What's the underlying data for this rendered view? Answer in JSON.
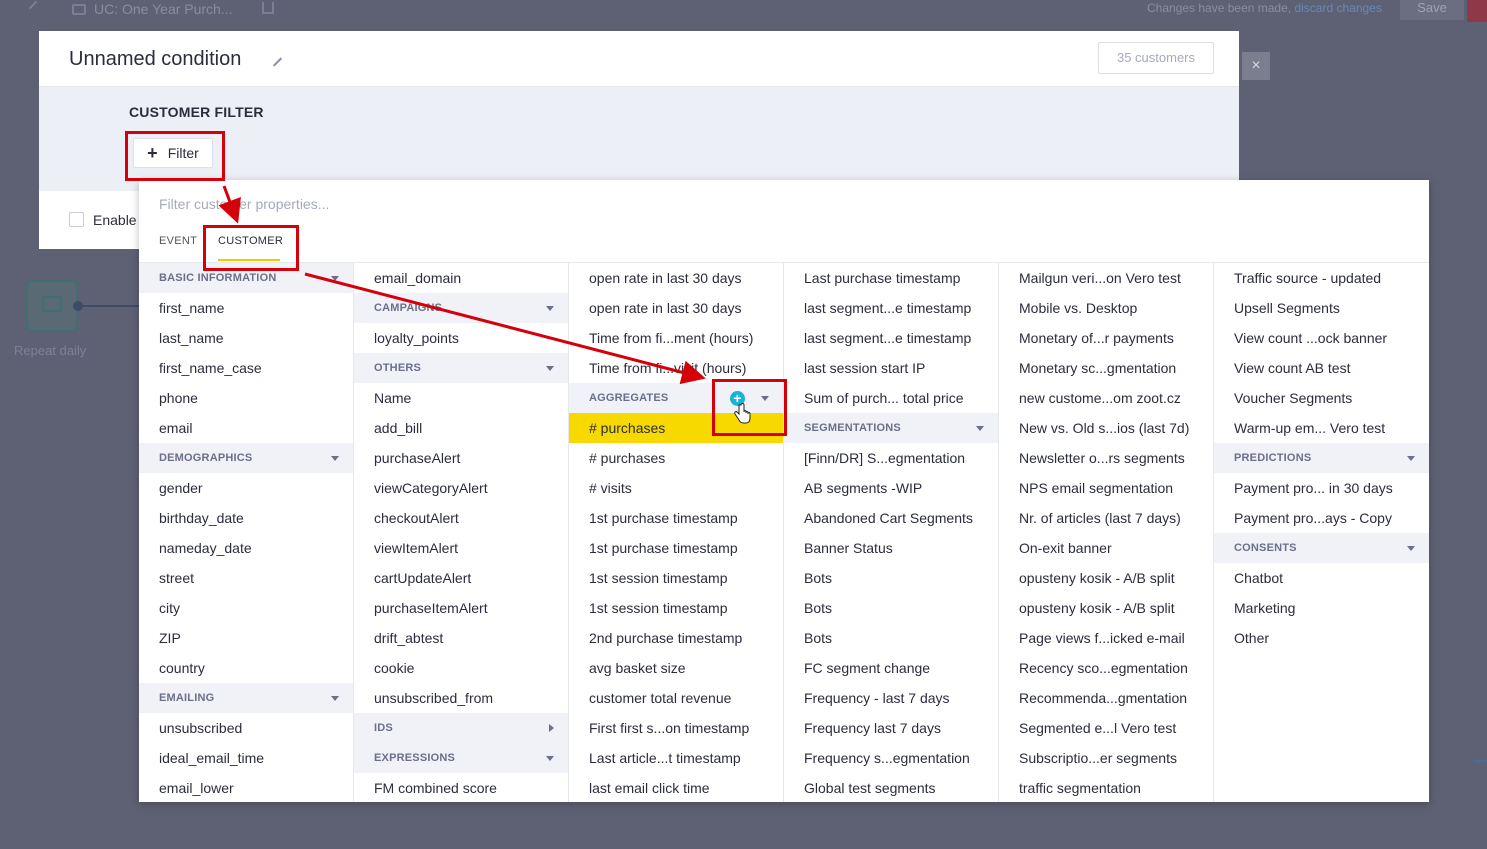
{
  "background": {
    "breadcrumb": "UC: One Year Purch...",
    "changes_text": "Changes have been made,",
    "discard_link": "discard changes",
    "save_label": "Save",
    "node_label": "Repeat daily"
  },
  "modal": {
    "title": "Unnamed condition",
    "customers_count": "35 customers",
    "filter_section_title": "CUSTOMER FILTER",
    "filter_button_label": "Filter",
    "enable_label": "Enable",
    "close_label": "×"
  },
  "picker": {
    "search_placeholder": "Filter customer properties...",
    "tabs": {
      "event": "EVENT",
      "customer": "CUSTOMER"
    },
    "columns": [
      [
        {
          "label": "BASIC INFORMATION",
          "type": "section",
          "caret": "down"
        },
        {
          "label": "first_name"
        },
        {
          "label": "last_name"
        },
        {
          "label": "first_name_case"
        },
        {
          "label": "phone"
        },
        {
          "label": "email"
        },
        {
          "label": "DEMOGRAPHICS",
          "type": "section",
          "caret": "down"
        },
        {
          "label": "gender"
        },
        {
          "label": "birthday_date"
        },
        {
          "label": "nameday_date"
        },
        {
          "label": "street"
        },
        {
          "label": "city"
        },
        {
          "label": "ZIP"
        },
        {
          "label": "country"
        },
        {
          "label": "EMAILING",
          "type": "section",
          "caret": "down"
        },
        {
          "label": "unsubscribed"
        },
        {
          "label": "ideal_email_time"
        },
        {
          "label": "email_lower"
        }
      ],
      [
        {
          "label": "email_domain"
        },
        {
          "label": "CAMPAIGNS",
          "type": "section",
          "caret": "down"
        },
        {
          "label": "loyalty_points"
        },
        {
          "label": "OTHERS",
          "type": "section",
          "caret": "down"
        },
        {
          "label": "Name"
        },
        {
          "label": "add_bill"
        },
        {
          "label": "purchaseAlert"
        },
        {
          "label": "viewCategoryAlert"
        },
        {
          "label": "checkoutAlert"
        },
        {
          "label": "viewItemAlert"
        },
        {
          "label": "cartUpdateAlert"
        },
        {
          "label": "purchaseItemAlert"
        },
        {
          "label": "drift_abtest"
        },
        {
          "label": "cookie"
        },
        {
          "label": "unsubscribed_from"
        },
        {
          "label": "IDS",
          "type": "section",
          "caret": "right"
        },
        {
          "label": "EXPRESSIONS",
          "type": "section",
          "caret": "down"
        },
        {
          "label": "FM combined score"
        }
      ],
      [
        {
          "label": "open rate in last 30 days"
        },
        {
          "label": "open rate in last 30 days"
        },
        {
          "label": "Time from fi...ment (hours)"
        },
        {
          "label": "Time from fi...visit (hours)"
        },
        {
          "label": "AGGREGATES",
          "type": "section",
          "caret": "down",
          "add": true
        },
        {
          "label": "# purchases",
          "highlight": true
        },
        {
          "label": "# purchases"
        },
        {
          "label": "# visits"
        },
        {
          "label": "1st purchase timestamp"
        },
        {
          "label": "1st purchase timestamp"
        },
        {
          "label": "1st session timestamp"
        },
        {
          "label": "1st session timestamp"
        },
        {
          "label": "2nd purchase timestamp"
        },
        {
          "label": "avg basket size"
        },
        {
          "label": "customer total revenue"
        },
        {
          "label": "First first s...on timestamp"
        },
        {
          "label": "Last article...t timestamp"
        },
        {
          "label": "last email click time"
        }
      ],
      [
        {
          "label": "Last purchase timestamp"
        },
        {
          "label": "last segment...e timestamp"
        },
        {
          "label": "last segment...e timestamp"
        },
        {
          "label": "last session start IP"
        },
        {
          "label": "Sum of purch... total price"
        },
        {
          "label": "SEGMENTATIONS",
          "type": "section",
          "caret": "down"
        },
        {
          "label": "[Finn/DR] S...egmentation"
        },
        {
          "label": "AB segments -WIP"
        },
        {
          "label": "Abandoned Cart Segments"
        },
        {
          "label": "Banner Status"
        },
        {
          "label": "Bots"
        },
        {
          "label": "Bots"
        },
        {
          "label": "Bots"
        },
        {
          "label": "FC segment change"
        },
        {
          "label": "Frequency - last 7 days"
        },
        {
          "label": "Frequency last 7 days"
        },
        {
          "label": "Frequency s...egmentation"
        },
        {
          "label": "Global test segments"
        }
      ],
      [
        {
          "label": "Mailgun veri...on Vero test"
        },
        {
          "label": "Mobile vs. Desktop"
        },
        {
          "label": "Monetary of...r payments"
        },
        {
          "label": "Monetary sc...gmentation"
        },
        {
          "label": "new custome...om zoot.cz"
        },
        {
          "label": "New vs. Old s...ios (last 7d)"
        },
        {
          "label": "Newsletter o...rs segments"
        },
        {
          "label": "NPS email segmentation"
        },
        {
          "label": "Nr. of articles (last 7 days)"
        },
        {
          "label": "On-exit banner"
        },
        {
          "label": "opusteny kosik - A/B split"
        },
        {
          "label": "opusteny kosik - A/B split"
        },
        {
          "label": "Page views f...icked e-mail"
        },
        {
          "label": "Recency sco...egmentation"
        },
        {
          "label": "Recommenda...gmentation"
        },
        {
          "label": "Segmented e...l Vero test"
        },
        {
          "label": "Subscriptio...er segments"
        },
        {
          "label": "traffic segmentation"
        }
      ],
      [
        {
          "label": "Traffic source - updated"
        },
        {
          "label": "Upsell Segments"
        },
        {
          "label": "View count ...ock banner"
        },
        {
          "label": "View count AB test"
        },
        {
          "label": "Voucher Segments"
        },
        {
          "label": "Warm-up em... Vero test"
        },
        {
          "label": "PREDICTIONS",
          "type": "section",
          "caret": "down"
        },
        {
          "label": "Payment pro... in 30 days"
        },
        {
          "label": "Payment pro...ays - Copy"
        },
        {
          "label": "CONSENTS",
          "type": "section",
          "caret": "down"
        },
        {
          "label": "Chatbot"
        },
        {
          "label": "Marketing"
        },
        {
          "label": "Other"
        }
      ]
    ]
  },
  "colors": {
    "highlight": "#f7d900",
    "annotation_red": "#d4000a",
    "add_icon": "#19b3d6",
    "tab_underline": "#f3c900"
  }
}
